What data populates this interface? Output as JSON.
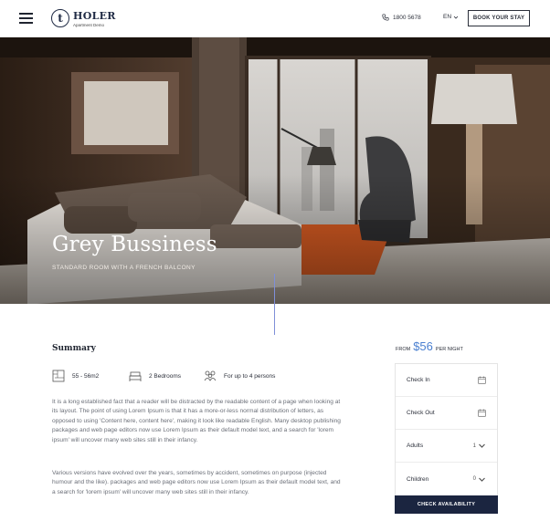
{
  "header": {
    "logo_letter": "t",
    "logo_name": "HOLER",
    "logo_sub": "Apartment Demo",
    "phone": "1800 5678",
    "language": "EN",
    "book_label": "BOOK YOUR STAY"
  },
  "hero": {
    "title": "Grey Bussiness",
    "subtitle": "STANDARD ROOM WITH A FRENCH BALCONY"
  },
  "summary": {
    "title": "Summary",
    "features": [
      {
        "icon": "floor-plan-icon",
        "label": "55 - 56m2"
      },
      {
        "icon": "bed-icon",
        "label": "2 Bedrooms"
      },
      {
        "icon": "guests-icon",
        "label": "For up to 4 persons"
      }
    ],
    "paragraph1": "It is a long established fact that a reader will be distracted by the readable content of a page when looking at its layout. The point of using Lorem Ipsum is that it has a more-or-less normal distribution of letters, as opposed to using 'Content here, content here', making it look like readable English. Many desktop publishing packages and web page editors now use Lorem Ipsum as their default model text, and a search for 'lorem ipsum' will uncover many web sites still in their infancy.",
    "paragraph2": "Various versions have evolved over the years, sometimes by accident, sometimes on purpose (injected humour and the like). packages and web page editors now use Lorem Ipsum as their default model text, and a search for 'lorem ipsum' will uncover many web sites still in their infancy."
  },
  "booking": {
    "from_label": "FROM",
    "price": "$56",
    "per_night": "PER NIGHT",
    "check_in": "Check In",
    "check_out": "Check Out",
    "adults_label": "Adults",
    "adults_value": "1",
    "children_label": "Children",
    "children_value": "0",
    "button_label": "CHECK AVAILABILITY"
  },
  "colors": {
    "accent": "#4a7fd0",
    "dark_navy": "#1b2540",
    "scroll_line": "#7f8fd8"
  }
}
